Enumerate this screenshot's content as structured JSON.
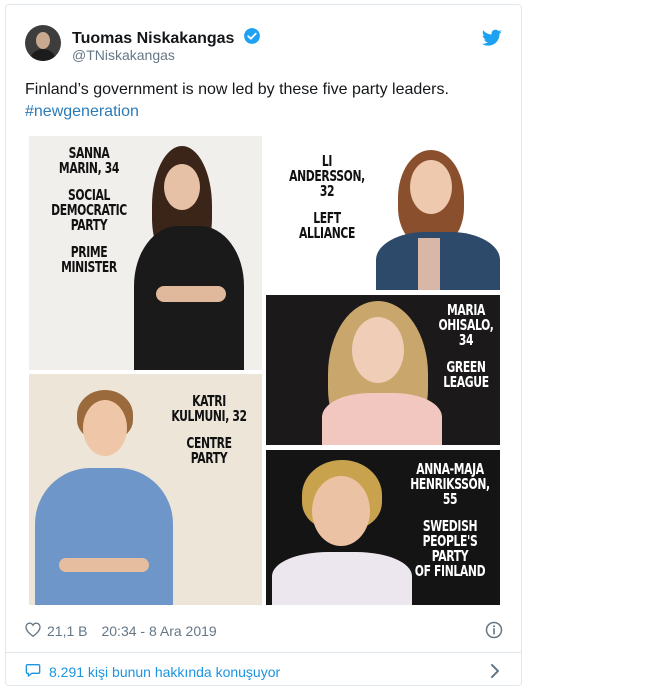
{
  "tweet": {
    "author_name": "Tuomas Niskakangas",
    "author_handle": "@TNiskakangas",
    "text": "Finland’s government is now led by these five party leaders.",
    "hashtag": "#newgeneration",
    "likes": "21,1 B",
    "timestamp": "20:34 - 8 Ara 2019",
    "conversation": "8.291 kişi bunun hakkında konuşuyor"
  },
  "photos": [
    {
      "lines": [
        "SANNA",
        "MARIN, 34",
        "",
        "SOCIAL",
        "DEMOCRATIC",
        "PARTY",
        "",
        "PRIME",
        "MINISTER"
      ]
    },
    {
      "lines": [
        "LI",
        "ANDERSSON, 32",
        "",
        "LEFT",
        "ALLIANCE"
      ]
    },
    {
      "lines": [
        "MARIA",
        "OHISALO, 34",
        "",
        "GREEN",
        "LEAGUE"
      ]
    },
    {
      "lines": [
        "KATRI",
        "KULMUNI, 32",
        "",
        "CENTRE",
        "PARTY"
      ]
    },
    {
      "lines": [
        "ANNA-MAJA",
        "HENRIKSSON, 55",
        "",
        "SWEDISH",
        "PEOPLE'S",
        "PARTY",
        "OF FINLAND"
      ]
    }
  ],
  "colors": {
    "link": "#1b95e0",
    "hashtag": "#2b7bb9",
    "secondary_text": "#657786",
    "verified": "#1da1f2"
  },
  "icons": [
    "avatar",
    "verified-badge-icon",
    "twitter-bird-icon",
    "heart-icon",
    "info-icon",
    "speech-bubble-icon",
    "chevron-right-icon"
  ]
}
